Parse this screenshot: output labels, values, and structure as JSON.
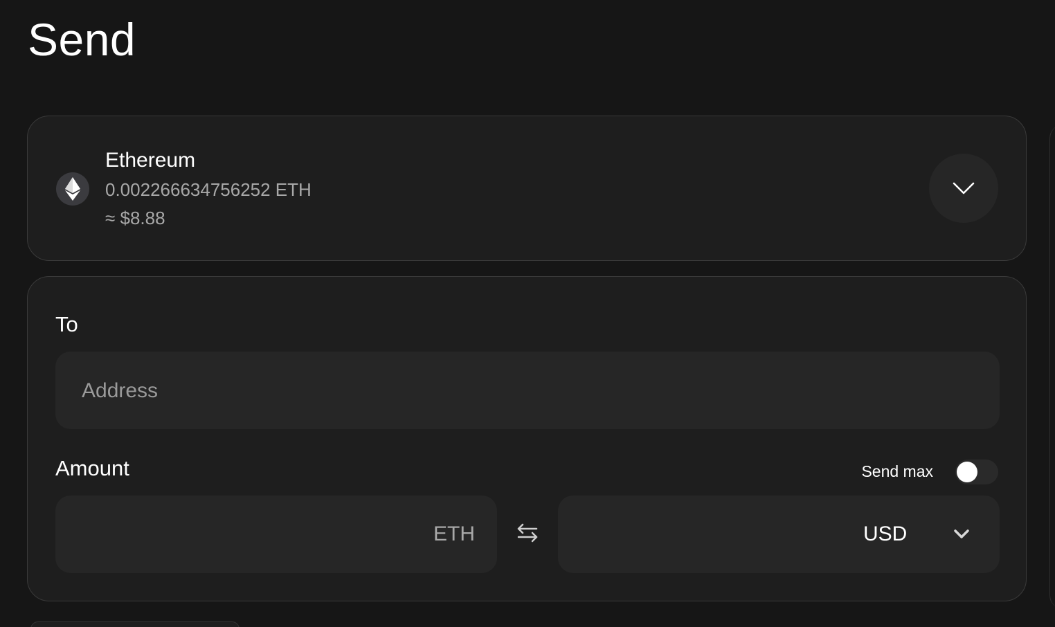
{
  "header": {
    "title": "Send"
  },
  "asset": {
    "name": "Ethereum",
    "balance": "0.002266634756252 ETH",
    "fiat_value": "≈ $8.88",
    "icon": "ethereum-icon",
    "dropdown_icon": "chevron-down-icon"
  },
  "form": {
    "to_label": "To",
    "address_placeholder": "Address",
    "address_value": "",
    "amount_label": "Amount",
    "send_max_label": "Send max",
    "send_max_enabled": false,
    "eth_amount_value": "",
    "eth_unit": "ETH",
    "swap_icon": "swap-arrows-icon",
    "fiat_currency": "USD",
    "fiat_chevron_icon": "chevron-down-icon"
  },
  "colors": {
    "background": "#161616",
    "card": "#1e1e1e",
    "field": "#262626",
    "border": "#3a3a3a",
    "text_primary": "#ffffff",
    "text_secondary": "#a8a8a8"
  }
}
